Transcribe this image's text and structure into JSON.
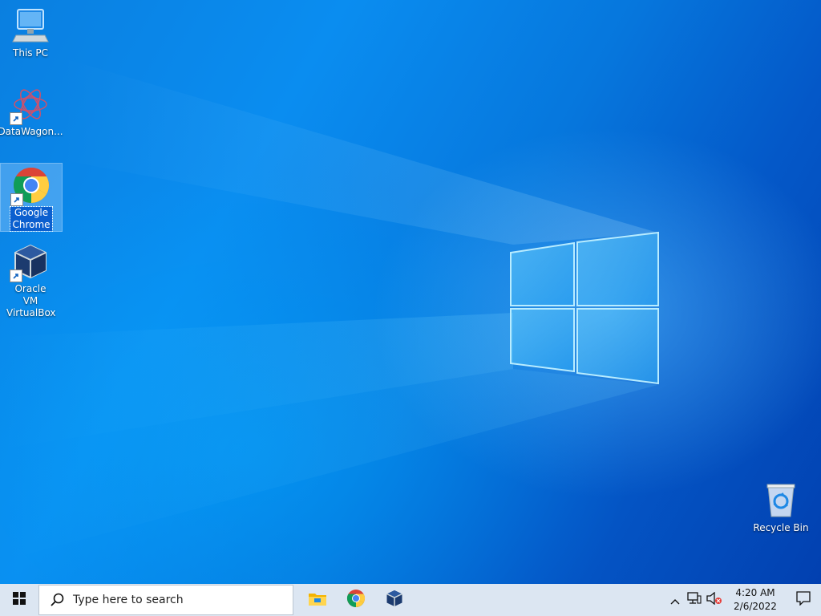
{
  "desktop": {
    "icons": [
      {
        "label": "This PC"
      },
      {
        "label": "DataWagon..."
      },
      {
        "label": "Google Chrome"
      },
      {
        "label": "Oracle VM VirtualBox"
      },
      {
        "label": "Recycle Bin"
      }
    ]
  },
  "taskbar": {
    "search_placeholder": "Type here to search",
    "pinned": [
      "file-explorer-icon",
      "chrome-icon",
      "virtualbox-icon"
    ],
    "clock": {
      "time": "4:20 AM",
      "date": "2/6/2022"
    }
  },
  "colors": {
    "taskbar_bg": "#dce6f2",
    "selection": "#0b5fcf"
  }
}
